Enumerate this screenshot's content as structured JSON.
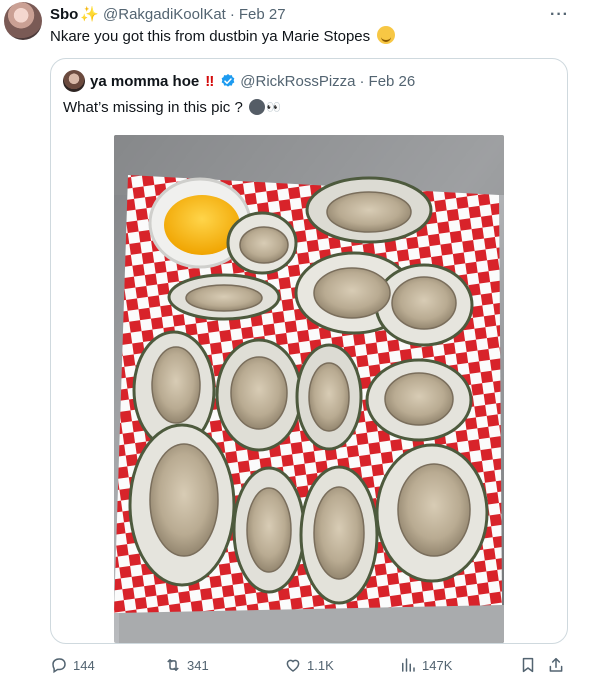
{
  "tweet": {
    "author_name": "Sbo",
    "author_emoji": "sparkles-icon",
    "author_handle": "@RakgadiKoolKat",
    "separator": "·",
    "date": "Feb 27",
    "text": "Nkare you got this from dustbin ya Marie Stopes",
    "text_emoji": "smiling-face-icon",
    "more_label": "···"
  },
  "quote": {
    "author_name": "ya momma hoe",
    "author_name_suffix": "‼",
    "verified_icon": "verified-badge-icon",
    "author_handle": "@RickRossPizza",
    "separator": "·",
    "date": "Feb 26",
    "text": "What’s missing in this pic ?",
    "text_emoji": "dark-face-with-eyes-icon",
    "image_description": "oysters-on-checkered-paper-photo"
  },
  "actions": {
    "replies": "144",
    "reposts": "341",
    "likes": "1.1K",
    "views": "147K",
    "bookmark_icon": "bookmark-icon",
    "share_icon": "share-icon"
  },
  "colors": {
    "text_primary": "#0f1419",
    "text_secondary": "#536471",
    "border": "#cfd9de",
    "verified": "#1d9bf0",
    "bang_red": "#d40b0b"
  }
}
